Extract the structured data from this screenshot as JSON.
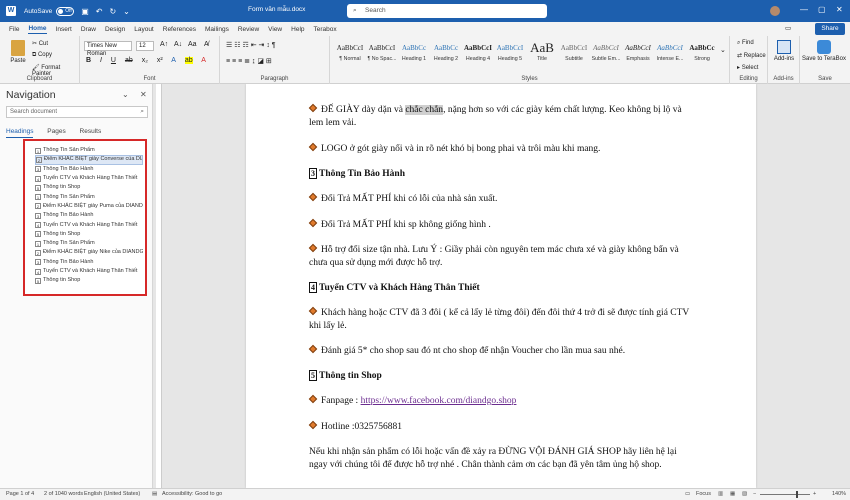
{
  "titlebar": {
    "autosave_label": "AutoSave",
    "toggle_state": "Off",
    "doc_title": "Form văn mẫu.docx",
    "search_placeholder": "Search"
  },
  "menu": {
    "tabs": [
      "File",
      "Home",
      "Insert",
      "Draw",
      "Design",
      "Layout",
      "References",
      "Mailings",
      "Review",
      "View",
      "Help",
      "Terabox"
    ],
    "active": "Home",
    "share_label": "Share"
  },
  "ribbon": {
    "clipboard": {
      "paste": "Paste",
      "cut": "Cut",
      "copy": "Copy",
      "format_painter": "Format Painter",
      "label": "Clipboard"
    },
    "font": {
      "name": "Times New Roman",
      "size": "12",
      "label": "Font"
    },
    "paragraph_label": "Paragraph",
    "styles": [
      {
        "sample": "AaBbCcI",
        "name": "¶ Normal"
      },
      {
        "sample": "AaBbCcI",
        "name": "¶ No Spac..."
      },
      {
        "sample": "AaBbCc",
        "name": "Heading 1"
      },
      {
        "sample": "AaBbCc",
        "name": "Heading 2"
      },
      {
        "sample": "AaBbCcI",
        "name": "Heading 4"
      },
      {
        "sample": "AaBbCcI",
        "name": "Heading 5"
      },
      {
        "sample": "AaB",
        "name": "Title"
      },
      {
        "sample": "AaBbCcI",
        "name": "Subtitle"
      },
      {
        "sample": "AaBbCcI",
        "name": "Subtle Em..."
      },
      {
        "sample": "AaBbCcI",
        "name": "Emphasis"
      },
      {
        "sample": "AaBbCcI",
        "name": "Intense E..."
      },
      {
        "sample": "AaBbCc",
        "name": "Strong"
      }
    ],
    "styles_label": "Styles",
    "editing": {
      "find": "Find",
      "replace": "Replace",
      "select": "Select",
      "label": "Editing"
    },
    "addins": {
      "addins": "Add-ins",
      "save_terabox": "Save to TeraBox",
      "label_addins": "Add-ins",
      "label_save": "Save"
    }
  },
  "navigation": {
    "title": "Navigation",
    "search_placeholder": "Search document",
    "tabs": [
      "Headings",
      "Pages",
      "Results"
    ],
    "active_tab": "Headings",
    "headings": [
      {
        "num": "1",
        "text": "Thông Tin Sản Phẩm",
        "selected": false
      },
      {
        "num": "2",
        "text": "Điểm KHÁC BIỆT giày Converse của DIA...",
        "selected": true
      },
      {
        "num": "3",
        "text": "Thông Tin Bảo Hành",
        "selected": false
      },
      {
        "num": "4",
        "text": "Tuyển CTV và Khách Hàng Thân Thiết",
        "selected": false
      },
      {
        "num": "5",
        "text": "Thông tin Shop",
        "selected": false
      },
      {
        "num": "1",
        "text": "Thông Tin Sản Phẩm",
        "selected": false
      },
      {
        "num": "2",
        "text": "Điểm KHÁC BIỆT giày Puma của DIAND...",
        "selected": false
      },
      {
        "num": "3",
        "text": "Thông Tin Bảo Hành",
        "selected": false
      },
      {
        "num": "4",
        "text": "Tuyển CTV và Khách Hàng Thân Thiết",
        "selected": false
      },
      {
        "num": "5",
        "text": "Thông tin Shop",
        "selected": false
      },
      {
        "num": "1",
        "text": "Thông Tin Sản Phẩm",
        "selected": false
      },
      {
        "num": "2",
        "text": "Điểm KHÁC BIỆT giày Nike của DIANDG...",
        "selected": false
      },
      {
        "num": "3",
        "text": "Thông Tin Bảo Hành",
        "selected": false
      },
      {
        "num": "4",
        "text": "Tuyển CTV và Khách Hàng Thân Thiết",
        "selected": false
      },
      {
        "num": "5",
        "text": "Thông tin Shop",
        "selected": false
      }
    ]
  },
  "document": {
    "p1_a": "ĐẾ GIÀY dày dặn và ",
    "p1_hl": "chắc chắn",
    "p1_b": ", nặng hơn so với các giày kém chất lượng. Keo không bị lộ và lem lem vải.",
    "p2": "LOGO ở gót giày nổi và in rõ nét khó bị bong phai và trôi màu khi mang.",
    "h3_num": "3",
    "h3": "Thông Tin Bảo Hành",
    "p3": "Đổi Trả MẤT PHÍ khi có lỗi của nhà sản xuất.",
    "p4": "Đổi Trả MẤT PHÍ khi sp không giống hình .",
    "p5": "Hỗ trợ đổi size tận nhà. Lưu Ý : Giầy phải còn nguyên tem mác chưa xé và giày không bẩn và chưa qua sử dụng mới được hỗ trợ.",
    "h4_num": "4",
    "h4": "Tuyển CTV và Khách Hàng Thân Thiết",
    "p6": "Khách hàng hoặc CTV đã 3 đôi ( kể cả lấy lẻ từng đôi) đến đôi thứ 4 trở đi sẽ được tính giá CTV khi lấy lẻ.",
    "p7": "Đánh giá 5* cho shop sau đó nt cho shop để nhận Voucher cho lần mua sau nhé.",
    "h5_num": "5",
    "h5": "Thông tin Shop",
    "p8_label": "Fanpage : ",
    "p8_link": "https://www.facebook.com/diandgo.shop",
    "p9": "Hotline :0325756881",
    "p10": "Nếu khi nhận sản phẩm có lỗi hoặc vấn đề xảy ra ĐỪNG VỘI ĐÁNH GIÁ SHOP hãy liên hệ lại ngay với chúng tôi để được hỗ trợ nhé . Chân thành cảm ơn các bạn đã yên tâm ủng hộ shop."
  },
  "status": {
    "page": "Page 1 of 4",
    "words": "2 of 1040 words",
    "language": "English (United States)",
    "accessibility": "Accessibility: Good to go",
    "focus": "Focus",
    "zoom": "140%"
  }
}
